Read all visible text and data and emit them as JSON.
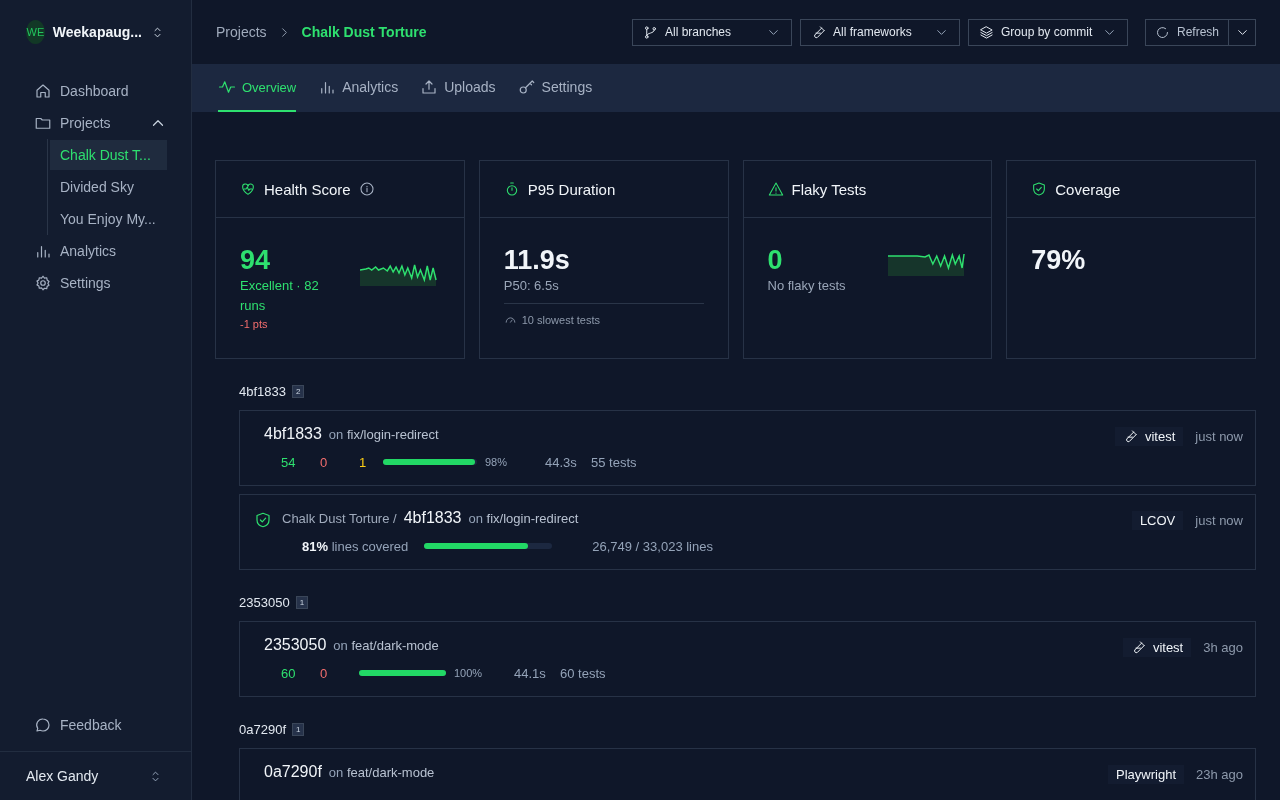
{
  "sidebar": {
    "workspace": {
      "initials": "WE",
      "name": "Weekapaug..."
    },
    "nav": [
      {
        "label": "Dashboard"
      },
      {
        "label": "Projects",
        "expanded": true,
        "children": [
          {
            "label": "Chalk Dust T...",
            "selected": true
          },
          {
            "label": "Divided Sky",
            "selected": false
          },
          {
            "label": "You Enjoy My...",
            "selected": false
          }
        ]
      },
      {
        "label": "Analytics"
      },
      {
        "label": "Settings"
      }
    ],
    "feedback": "Feedback",
    "user": "Alex Gandy"
  },
  "breadcrumb": [
    "Projects",
    "Chalk Dust Torture"
  ],
  "filters": [
    "All branches",
    "All frameworks",
    "Group by commit"
  ],
  "refresh": "Refresh",
  "tabs": [
    {
      "label": "Overview",
      "selected": true
    },
    {
      "label": "Analytics",
      "selected": false
    },
    {
      "label": "Uploads",
      "selected": false
    },
    {
      "label": "Settings",
      "selected": false
    }
  ],
  "metrics": [
    {
      "kind": "health",
      "title": "Health Score",
      "value": "94",
      "status": "Excellent · 82 runs",
      "delta": "-1 pts"
    },
    {
      "kind": "duration",
      "title": "P95 Duration",
      "value": "11.9s",
      "sub": "P50: 6.5s",
      "link": "10 slowest tests"
    },
    {
      "kind": "flaky",
      "title": "Flaky Tests",
      "value": "0",
      "sub": "No flaky tests"
    },
    {
      "kind": "coverage",
      "title": "Coverage",
      "value": "79%"
    }
  ],
  "groups": [
    {
      "commit": "4bf1833",
      "count": "2",
      "runs": [
        {
          "kind": "tests",
          "commit": "4bf1833",
          "branch_prefix": "on",
          "branch": "fix/login-redirect",
          "passed": "54",
          "failed": "0",
          "flaky": "1",
          "level": 0.98,
          "percent": "98%",
          "duration": "44.3s",
          "tests": "55 tests",
          "framework": "vitest",
          "framework_icon": true,
          "time": "just now"
        },
        {
          "kind": "coverage",
          "project": "Chalk Dust Torture /",
          "commit": "4bf1833",
          "branch_prefix": "on",
          "branch": "fix/login-redirect",
          "percent": "81%",
          "label": "lines covered",
          "level": 0.81,
          "lines": "26,749 / 33,023 lines",
          "framework": "LCOV",
          "framework_icon": false,
          "time": "just now"
        }
      ]
    },
    {
      "commit": "2353050",
      "count": "1",
      "runs": [
        {
          "kind": "tests",
          "commit": "2353050",
          "branch_prefix": "on",
          "branch": "feat/dark-mode",
          "passed": "60",
          "failed": "0",
          "level": 1,
          "percent": "100%",
          "duration": "44.1s",
          "tests": "60 tests",
          "framework": "vitest",
          "framework_icon": true,
          "time": "3h ago"
        }
      ]
    },
    {
      "commit": "0a7290f",
      "count": "1",
      "runs": [
        {
          "kind": "tests",
          "commit": "0a7290f",
          "branch_prefix": "on",
          "branch": "feat/dark-mode",
          "framework": "Playwright",
          "framework_icon": false,
          "time": "23h ago"
        }
      ]
    }
  ]
}
